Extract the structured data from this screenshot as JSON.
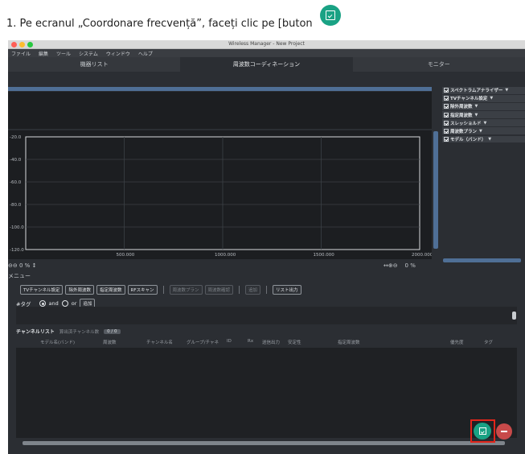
{
  "instruction": {
    "text": "1. Pe ecranul „Coordonare frecvență”, faceți clic pe [buton",
    "button_icon": "edit-check-icon",
    "accent": "#1aa284"
  },
  "window": {
    "title": "Wireless Manager - New Project",
    "menu": [
      "ファイル",
      "編集",
      "ツール",
      "システム",
      "ウィンドウ",
      "ヘルプ"
    ],
    "tabs": [
      "機器リスト",
      "周波数コーディネーション",
      "モニター"
    ],
    "active_tab": 1
  },
  "chart_data": {
    "type": "line",
    "x_ticks": [
      "500.000",
      "1000.000",
      "1500.000",
      "2000.000"
    ],
    "y_ticks": [
      "-20.0",
      "-40.0",
      "-60.0",
      "-80.0",
      "-100.0",
      "-120.0"
    ],
    "xlim": [
      0,
      2000
    ],
    "ylim": [
      -120,
      -20
    ],
    "grid": true,
    "series": []
  },
  "zoom": {
    "left_value": "0 %",
    "right_value": "0 %"
  },
  "right_panel": {
    "items": [
      {
        "label": "スペクトラムアナライザー",
        "checked": true
      },
      {
        "label": "TVチャンネル設定",
        "checked": true
      },
      {
        "label": "除外周波数",
        "checked": true
      },
      {
        "label": "指定周波数",
        "checked": true
      },
      {
        "label": "スレッショルド",
        "checked": true
      },
      {
        "label": "周波数プラン",
        "checked": true
      },
      {
        "label": "モデル（バンド）",
        "checked": true
      }
    ]
  },
  "menu_section": {
    "title": "メニュー",
    "buttons": [
      {
        "label": "TVチャンネル設定",
        "enabled": true
      },
      {
        "label": "除外周波数",
        "enabled": true
      },
      {
        "label": "指定周波数",
        "enabled": true
      },
      {
        "label": "RFスキャン",
        "enabled": true
      },
      {
        "label": "周波数プラン",
        "enabled": false
      },
      {
        "label": "周波数確認",
        "enabled": false
      },
      {
        "label": "追加",
        "enabled": false
      },
      {
        "label": "リスト出力",
        "enabled": true
      }
    ],
    "tag_label": "#タグ",
    "and_label": "and",
    "or_label": "or",
    "add_label": "追加"
  },
  "channel_list": {
    "title": "チャンネルリスト",
    "subtitle": "算出済チャンネル数",
    "count": "0 / 0",
    "columns": [
      "モデル名(バンド)",
      "周波数",
      "チャンネル名",
      "グループ/チャネ",
      "ID",
      "Rx",
      "送信出力",
      "安定性",
      "指定周波数",
      "優先度",
      "タグ"
    ]
  }
}
